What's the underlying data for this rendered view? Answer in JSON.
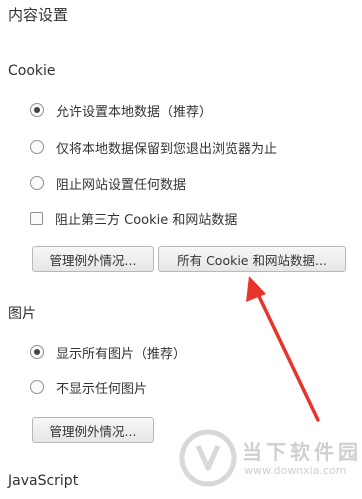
{
  "page_title": "内容设置",
  "cookie": {
    "heading": "Cookie",
    "options": [
      {
        "label": "允许设置本地数据（推荐）",
        "type": "radio",
        "checked": true
      },
      {
        "label": "仅将本地数据保留到您退出浏览器为止",
        "type": "radio",
        "checked": false
      },
      {
        "label": "阻止网站设置任何数据",
        "type": "radio",
        "checked": false
      },
      {
        "label": "阻止第三方 Cookie 和网站数据",
        "type": "checkbox",
        "checked": false
      }
    ],
    "manage_exceptions_label": "管理例外情况...",
    "all_cookies_label": "所有 Cookie 和网站数据..."
  },
  "images": {
    "heading": "图片",
    "options": [
      {
        "label": "显示所有图片（推荐）",
        "type": "radio",
        "checked": true
      },
      {
        "label": "不显示任何图片",
        "type": "radio",
        "checked": false
      }
    ],
    "manage_exceptions_label": "管理例外情况..."
  },
  "javascript": {
    "heading": "JavaScript"
  },
  "watermark": {
    "name": "当下软件园",
    "url": "www.downxia.com"
  },
  "colors": {
    "arrow": "#e8352b",
    "watermark": "#cfcfcf"
  }
}
